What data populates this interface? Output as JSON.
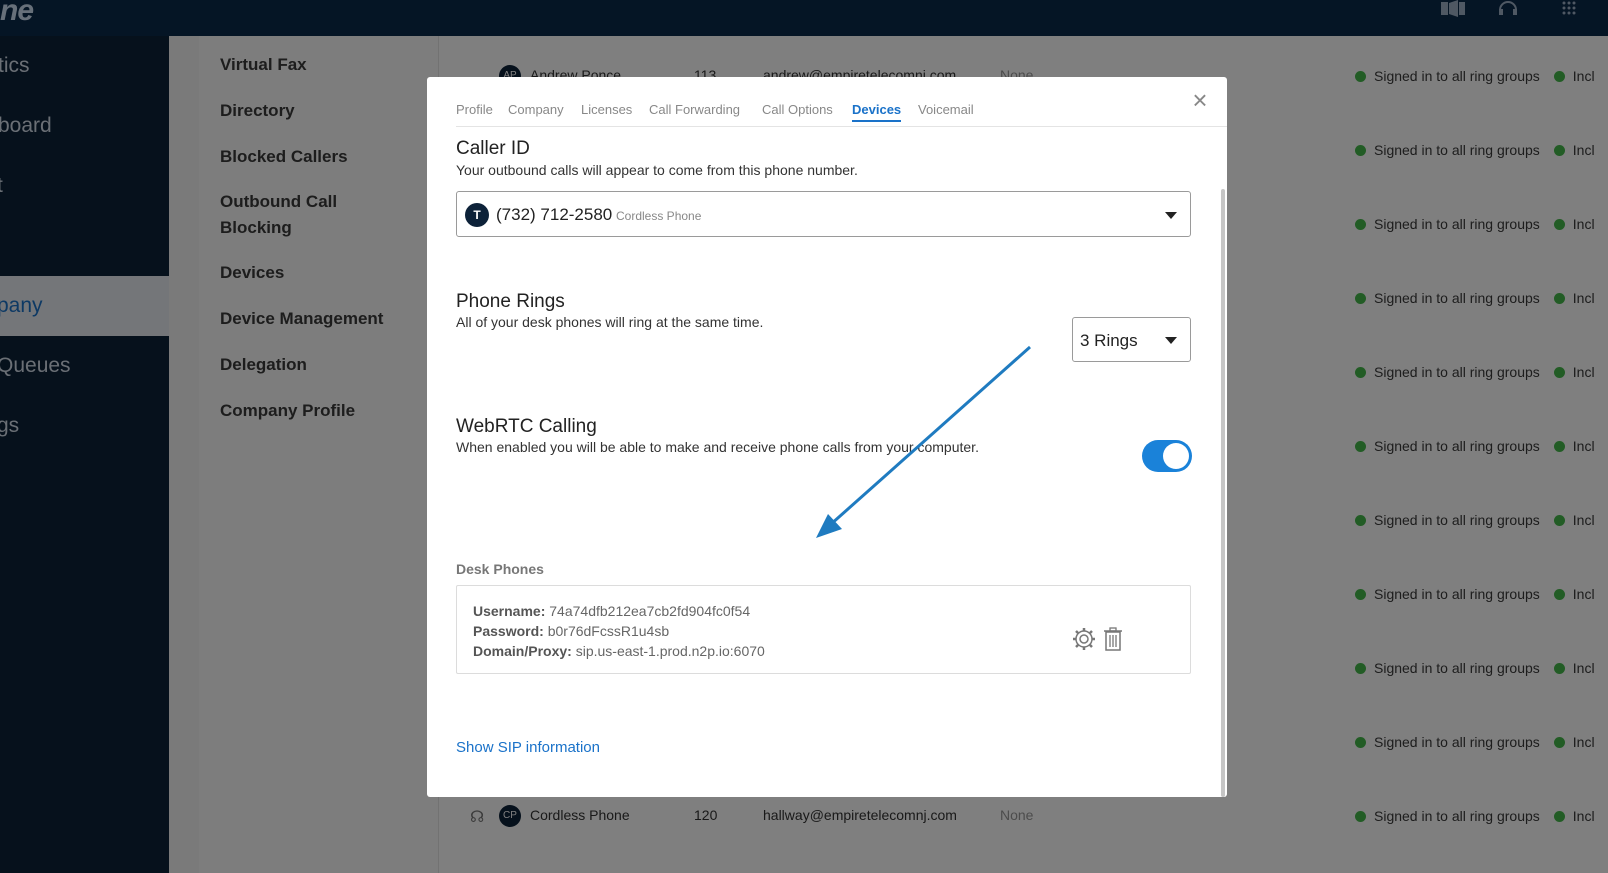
{
  "app": {
    "logo_text": "ne"
  },
  "topbar": {
    "icons": [
      "video-icon",
      "headset-icon",
      "dialpad-icon"
    ]
  },
  "leftnav": {
    "items": [
      {
        "label": "tics"
      },
      {
        "label": "board"
      },
      {
        "label": "t"
      },
      {
        "label": ""
      },
      {
        "label": "pany"
      },
      {
        "label": "Queues"
      },
      {
        "label": "gs"
      }
    ]
  },
  "subnav": {
    "items": [
      {
        "label": "Virtual Fax"
      },
      {
        "label": "Directory"
      },
      {
        "label": "Blocked Callers"
      },
      {
        "label": "Outbound Call Blocking"
      },
      {
        "label": "Devices"
      },
      {
        "label": "Device Management"
      },
      {
        "label": "Delegation"
      },
      {
        "label": "Company Profile"
      }
    ]
  },
  "background_table": {
    "top_row": {
      "initials": "AP",
      "name": "Andrew Ponce",
      "ext": "113",
      "email": "andrew@empiretelecomnj.com",
      "fwd": "None"
    },
    "bottom_row": {
      "initials": "CP",
      "name": "Cordless Phone",
      "ext": "120",
      "email": "hallway@empiretelecomnj.com",
      "fwd": "None"
    },
    "status_text": "Signed in to all ring groups",
    "status_extra": "Incl"
  },
  "modal": {
    "tabs": [
      {
        "label": "Profile"
      },
      {
        "label": "Company"
      },
      {
        "label": "Licenses"
      },
      {
        "label": "Call Forwarding"
      },
      {
        "label": "Call Options"
      },
      {
        "label": "Devices"
      },
      {
        "label": "Voicemail"
      }
    ],
    "active_tab": "Devices",
    "close_symbol": "×",
    "caller_id": {
      "title": "Caller ID",
      "description": "Your outbound calls will appear to come from this phone number.",
      "badge": "T",
      "number": "(732) 712-2580",
      "device_label": "Cordless Phone"
    },
    "phone_rings": {
      "title": "Phone Rings",
      "description": "All of your desk phones will ring at the same time.",
      "value": "3 Rings"
    },
    "webrtc": {
      "title": "WebRTC Calling",
      "description": "When enabled you will be able to make and receive phone calls from your computer.",
      "enabled": true
    },
    "desk_phones": {
      "title": "Desk Phones",
      "username_label": "Username:",
      "username": "74a74dfb212ea7cb2fd904fc0f54",
      "password_label": "Password:",
      "password": "b0r76dFcssR1u4sb",
      "domain_label": "Domain/Proxy:",
      "domain": "sip.us-east-1.prod.n2p.io:6070"
    },
    "sip_link": "Show SIP information"
  },
  "colors": {
    "accent": "#1a72c9",
    "toggle_on": "#1a82d9",
    "nav_dark": "#0d2239",
    "status_green": "#45b84a",
    "annotation_arrow": "#1f7bc0"
  }
}
